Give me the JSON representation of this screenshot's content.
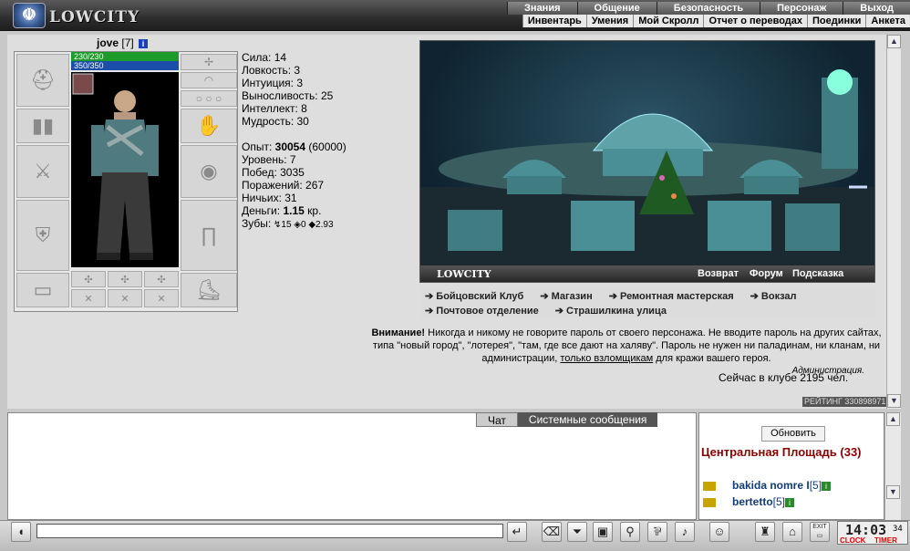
{
  "logo": {
    "text": "LOWCITY"
  },
  "menu_top": [
    "Знания",
    "Общение",
    "Безопасность",
    "Персонаж",
    "Выход"
  ],
  "menu_sub": [
    "Инвентарь",
    "Умения",
    "Мой Скролл",
    "Отчет о переводах",
    "Поединки",
    "Анкета"
  ],
  "character": {
    "name": "jove",
    "level": "[7]",
    "hp": "230/230",
    "mana": "350/350",
    "stats": [
      "Сила: 14",
      "Ловкость: 3",
      "Интуиция: 3",
      "Выносливость: 25",
      "Интеллект: 8",
      "Мудрость: 30"
    ],
    "exp_label": "Опыт:",
    "exp_value": "30054",
    "exp_next": "(60000)",
    "info": [
      "Уровень: 7",
      "Побед: 3035",
      "Поражений: 267",
      "Ничьих: 31"
    ],
    "money_label": "Деньги:",
    "money_value": "1.15",
    "money_unit": "кр.",
    "teeth_label": "Зубы:",
    "teeth_1": "15",
    "teeth_2": "0",
    "teeth_3": "2.93"
  },
  "scene": {
    "title": "LOWCITY",
    "links": [
      "Возврат",
      "Форум",
      "Подсказка"
    ]
  },
  "locations": [
    [
      "Бойцовский Клуб",
      "Магазин",
      "Ремонтная мастерская",
      "Вокзал"
    ],
    [
      "Почтовое отделение",
      "Страшилкина улица"
    ]
  ],
  "warning": {
    "lead": "Внимание!",
    "text": "Никогда и никому не говорите пароль от своего персонажа. Не вводите пароль на других сайтах, типа \"новый город\", \"лотерея\", \"там, где все дают на халяву\". Пароль не нужен ни паладинам, ни кланам, ни администрации,",
    "link": "только взломщикам",
    "tail": "для кражи вашего героя.",
    "sign": "Администрация."
  },
  "online": "Сейчас в клубе 2195 чел.",
  "rating": "РЕЙТИНГ 330898971",
  "chat": {
    "tab_chat": "Чат",
    "tab_system": "Системные сообщения"
  },
  "users_panel": {
    "refresh": "Обновить",
    "room": "Центральная Площадь (33)",
    "users": [
      {
        "name": "bakida nomre I",
        "level": "[5]"
      },
      {
        "name": "bertetto",
        "level": "[5]"
      }
    ]
  },
  "clock": {
    "time": "14:03",
    "seconds": "34",
    "label_clock": "CLOCK",
    "label_timer": "TIMER",
    "exit": "EXIT"
  }
}
